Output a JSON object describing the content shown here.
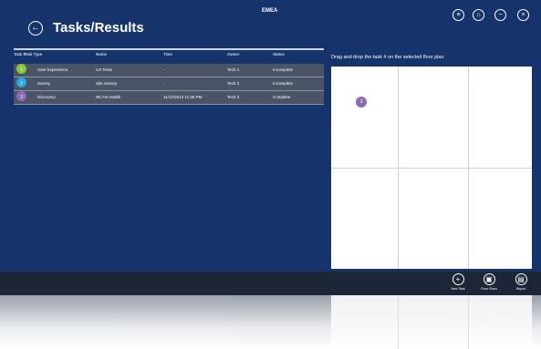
{
  "header": {
    "title": "Tasks/Results",
    "region": "EMEA"
  },
  "table": {
    "columns": [
      "Task #",
      "Task Type",
      "Name",
      "Time",
      "Owner",
      "Status"
    ],
    "rows": [
      {
        "num": "1",
        "type": "User Experience",
        "name": "UX Tests",
        "time": "-",
        "owner": "Tech 1",
        "status": "Incomplete",
        "color": "#8cc63f"
      },
      {
        "num": "2",
        "type": "Survey",
        "name": "Site Survey",
        "time": "-",
        "owner": "Tech 2",
        "status": "Incomplete",
        "color": "#27a9e1"
      },
      {
        "num": "3",
        "type": "Discovery",
        "name": "WLAN Health",
        "time": "11/12/2013 11:35 PM",
        "owner": "Tech 3",
        "status": "Complete",
        "color": "#8d6bb2"
      }
    ]
  },
  "floorplan": {
    "instruction": "Drag and drop the task # on the selected floor plan",
    "marker": "3"
  },
  "appbar": {
    "new_task": "New Task",
    "floor_plans": "Floor Plans",
    "report": "Report"
  },
  "icons": [
    "back-arrow-icon",
    "list-icon",
    "home-icon",
    "minus-icon",
    "close-icon",
    "plus-icon",
    "floor-plan-icon",
    "report-icon"
  ],
  "colors": {
    "background": "#16346b",
    "appbar": "#1d2636",
    "marker": "#8d6bb2"
  }
}
